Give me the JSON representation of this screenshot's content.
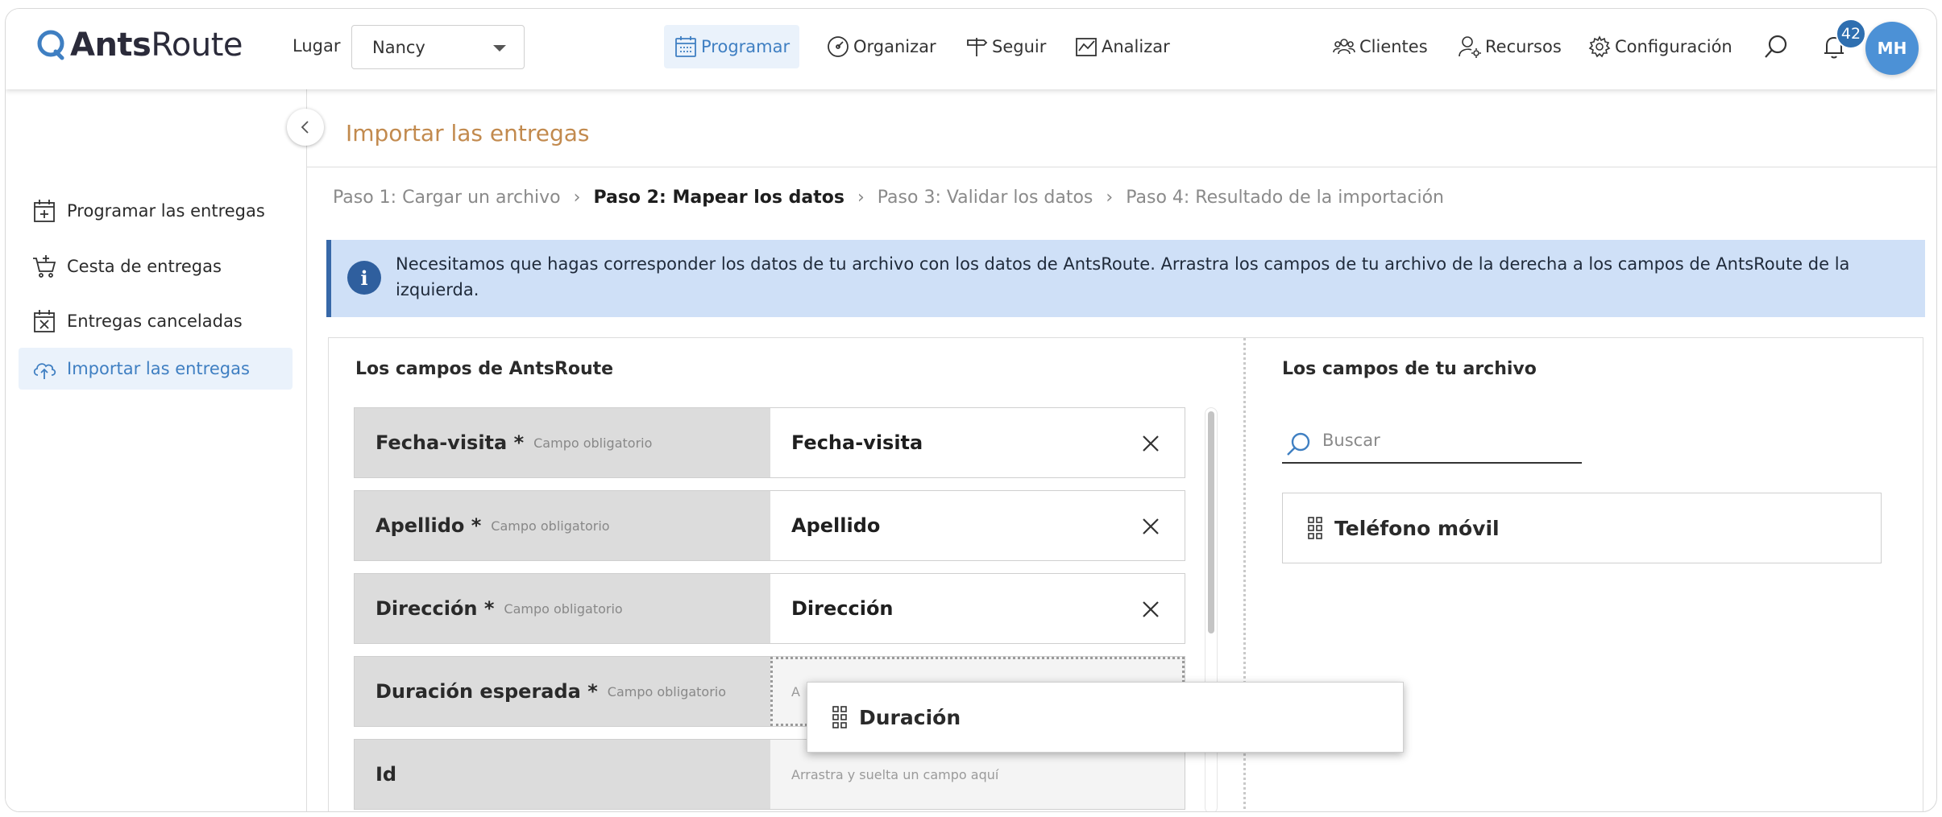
{
  "header": {
    "brand_bold": "Ants",
    "brand_light": "Route",
    "place_label": "Lugar",
    "place_value": "Nancy",
    "nav": {
      "programar": "Programar",
      "organizar": "Organizar",
      "seguir": "Seguir",
      "analizar": "Analizar",
      "clientes": "Clientes",
      "recursos": "Recursos",
      "configuracion": "Configuración"
    },
    "notifications_count": "42",
    "avatar_initials": "MH"
  },
  "sidebar": {
    "items": [
      {
        "label": "Programar las entregas"
      },
      {
        "label": "Cesta de entregas"
      },
      {
        "label": "Entregas canceladas"
      },
      {
        "label": "Importar las entregas"
      }
    ]
  },
  "page": {
    "title": "Importar las entregas",
    "steps": [
      {
        "label": "Paso 1: Cargar un archivo"
      },
      {
        "label": "Paso 2: Mapear los datos"
      },
      {
        "label": "Paso 3: Validar los datos"
      },
      {
        "label": "Paso 4: Resultado de la importación"
      }
    ],
    "info": "Necesitamos que hagas corresponder los datos de tu archivo con los datos de AntsRoute. Arrastra los campos de tu archivo de la derecha a los campos de AntsRoute de la izquierda."
  },
  "mapping": {
    "left_title": "Los campos de AntsRoute",
    "right_title": "Los campos de tu archivo",
    "required_hint": "Campo obligatorio",
    "drop_hint": "Arrastra y suelta un campo aquí",
    "drop_hint_truncated": "A",
    "rows": [
      {
        "label": "Fecha-visita *",
        "value": "Fecha-visita"
      },
      {
        "label": "Apellido *",
        "value": "Apellido"
      },
      {
        "label": "Dirección *",
        "value": "Dirección"
      },
      {
        "label": "Duración esperada *",
        "value": ""
      },
      {
        "label": "Id",
        "value": ""
      }
    ],
    "search_placeholder": "Buscar",
    "file_fields": [
      "Teléfono móvil"
    ],
    "dragging_field": "Duración"
  },
  "colors": {
    "accent": "#3f7fc2",
    "title": "#c28a4e",
    "info_bg": "#cfe0f7",
    "badge": "#2f6fb0",
    "avatar": "#4c91d6"
  }
}
